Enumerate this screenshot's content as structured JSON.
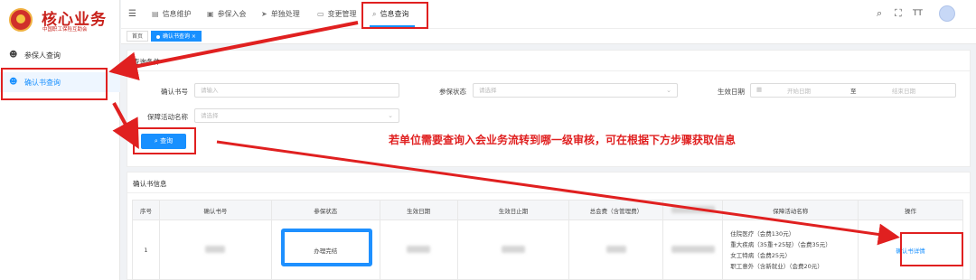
{
  "brand": {
    "title": "核心业务",
    "subtitle": "中国职工保险互助会"
  },
  "sidebar": {
    "items": [
      {
        "label": "参保人查询"
      },
      {
        "label": "确认书查询"
      }
    ]
  },
  "topnav": {
    "items": [
      {
        "label": "信息维护"
      },
      {
        "label": "参保入会"
      },
      {
        "label": "单独处理"
      },
      {
        "label": "变更管理"
      },
      {
        "label": "信息查询"
      }
    ]
  },
  "toolbar": {
    "font_label": "TT"
  },
  "tabs": [
    {
      "label": "首页"
    },
    {
      "label": "确认书查询"
    }
  ],
  "search": {
    "title": "查询条件",
    "confirm_no_label": "确认书号",
    "confirm_no_placeholder": "请输入",
    "status_label": "参保状态",
    "status_placeholder": "请选择",
    "effective_label": "生效日期",
    "start_placeholder": "开始日期",
    "range_sep": "至",
    "end_placeholder": "结束日期",
    "activity_label": "保障活动名称",
    "activity_placeholder": "请选择",
    "query_button": "查询"
  },
  "annotation": "若单位需要查询入会业务流转到哪一级审核，可在根据下方步骤获取信息",
  "results": {
    "title": "确认书信息",
    "columns": [
      "序号",
      "确认书号",
      "参保状态",
      "生效日期",
      "生效日止期",
      "总会费（含管理费）",
      "",
      "保障活动名称",
      "操作"
    ],
    "row": {
      "index": "1",
      "status": "办理完结",
      "activities": [
        "住院医疗（会费130元）",
        "重大疾病（35重+25轻）（会费35元）",
        "女工特病（会费25元）",
        "职工意外（含新就业）（会费20元）"
      ],
      "action": "确认书详情"
    }
  },
  "colors": {
    "primary": "#1890ff",
    "annotation_red": "#e02020",
    "brand_red": "#c8211b",
    "highlight_blue": "#1e90ff"
  }
}
